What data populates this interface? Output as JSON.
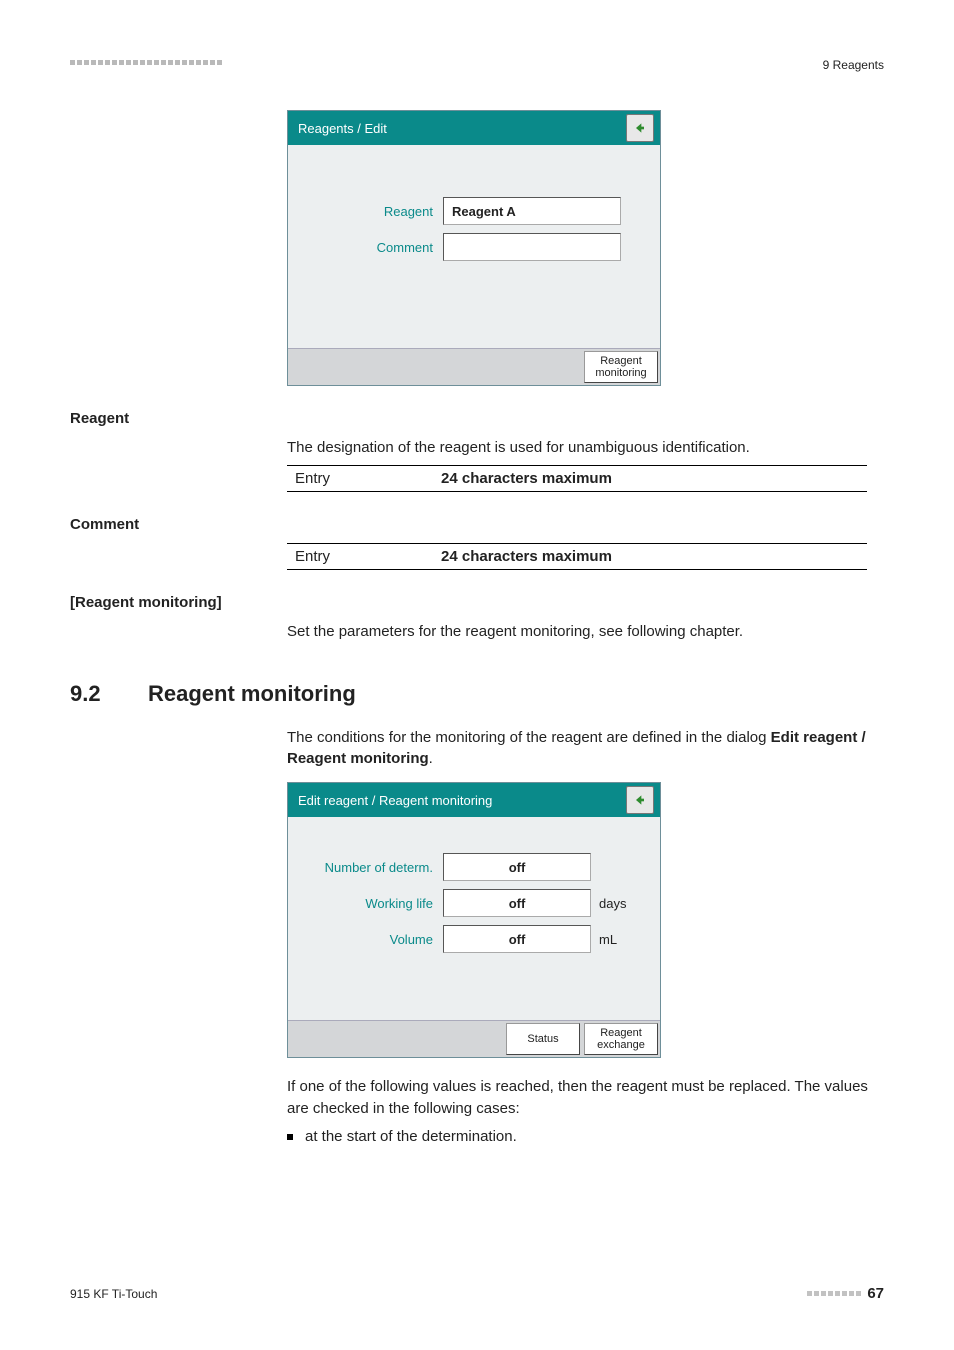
{
  "topHeader": "9 Reagents",
  "dialog1": {
    "title": "Reagents / Edit",
    "row1Label": "Reagent",
    "row1Value": "Reagent A",
    "row2Label": "Comment",
    "row2Value": "",
    "footerBtn": "Reagent monitoring"
  },
  "reagentLabel": "Reagent",
  "reagentDesc": "The designation of the reagent is used for unambiguous identification.",
  "entryLabel": "Entry",
  "entryValue": "24 characters maximum",
  "commentLabel": "Comment",
  "reagentMonLabel": "[Reagent monitoring]",
  "reagentMonDesc": "Set the parameters for the reagent monitoring, see following chapter.",
  "section": {
    "num": "9.2",
    "title": "Reagent monitoring"
  },
  "section92Para": "The conditions for the monitoring of the reagent are defined in the dialog ",
  "section92ParaBold": "Edit reagent / Reagent monitoring",
  "section92ParaEnd": ".",
  "dialog2": {
    "title": "Edit reagent / Reagent monitoring",
    "r1l": "Number of determ.",
    "r1v": "off",
    "r2l": "Working life",
    "r2v": "off",
    "r2u": "days",
    "r3l": "Volume",
    "r3v": "off",
    "r3u": "mL",
    "btnStatus": "Status",
    "btnExchange": "Reagent exchange"
  },
  "afterDialogPara": "If one of the following values is reached, then the reagent must be replaced. The values are checked in the following cases:",
  "bullet1": "at the start of the determination.",
  "footerLeft": "915 KF Ti-Touch",
  "pageNum": "67"
}
